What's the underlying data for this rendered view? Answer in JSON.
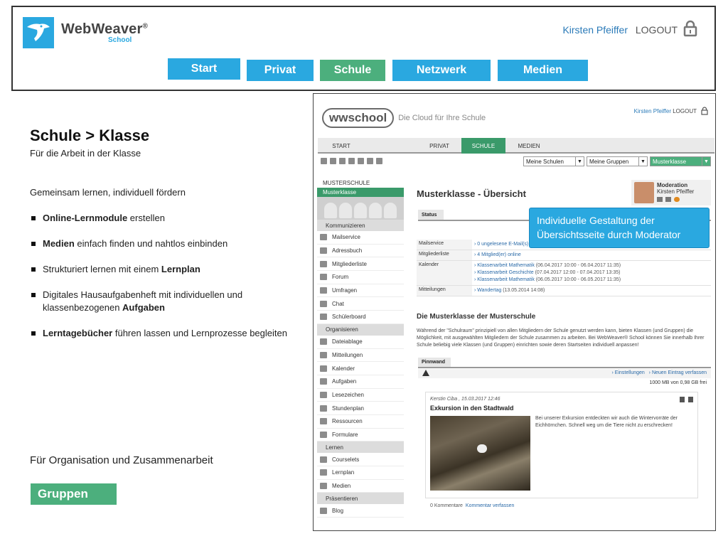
{
  "header": {
    "brand": "WebWeaver",
    "brand_mark": "®",
    "brand_sub": "School",
    "user": "Kirsten Pfeiffer",
    "logout": "LOGOUT",
    "nav": [
      {
        "label": "Start",
        "color": "#2aa8e0"
      },
      {
        "label": "Privat",
        "color": "#2aa8e0"
      },
      {
        "label": "Schule",
        "color": "#4caf7d"
      },
      {
        "label": "Netzwerk",
        "color": "#2aa8e0"
      },
      {
        "label": "Medien",
        "color": "#2aa8e0"
      }
    ]
  },
  "left": {
    "title": "Schule > Klasse",
    "subtitle": "Für die Arbeit in der Klasse",
    "lead": "Gemeinsam lernen, individuell fördern",
    "bullets": [
      {
        "bold_start": "Online-Lernmodule",
        "rest": " erstellen"
      },
      {
        "bold_start": "Medien",
        "rest": " einfach finden und nahtlos einbinden"
      },
      {
        "pre": "Strukturiert lernen mit einem ",
        "bold_end": "Lernplan"
      },
      {
        "pre": "Digitales Hausaufgabenheft mit individuellen und klassenbezogenen ",
        "bold_end": "Aufgaben"
      },
      {
        "bold_start": "Lerntagebücher",
        "rest": " führen lassen und Lernprozesse begleiten"
      }
    ],
    "org": "Für Organisation und Zusammenarbeit",
    "gruppen": "Gruppen"
  },
  "shot": {
    "logo": "wwschool",
    "tagline": "Die Cloud für Ihre Schule",
    "user": "Kirsten Pfeiffer",
    "logout": "LOGOUT",
    "tabs": [
      "START",
      "PRIVAT",
      "SCHULE",
      "MEDIEN"
    ],
    "selects": [
      "Meine Schulen",
      "Meine Gruppen",
      "Musterklasse"
    ],
    "school": "MUSTERSCHULE",
    "active_item": "Musterklasse",
    "sidebar": [
      {
        "head": "Kommunizieren",
        "items": [
          "Mailservice",
          "Adressbuch",
          "Mitgliederliste",
          "Forum",
          "Umfragen",
          "Chat",
          "Schülerboard"
        ]
      },
      {
        "head": "Organisieren",
        "items": [
          "Dateiablage",
          "Mitteilungen",
          "Kalender",
          "Aufgaben",
          "Lesezeichen",
          "Stundenplan",
          "Ressourcen",
          "Formulare"
        ]
      },
      {
        "head": "Lernen",
        "items": [
          "Courselets",
          "Lernplan",
          "Medien"
        ]
      },
      {
        "head": "Präsentieren",
        "items": [
          "Blog"
        ]
      }
    ],
    "main_title": "Musterklasse - Übersicht",
    "moderation_title": "Moderation",
    "moderation_name": "Kirsten Pfeiffer",
    "status_tab": "Status",
    "callout": "Individuelle Gestaltung der Übersichtsseite durch Moderator",
    "status_rows": [
      {
        "key": "Mailservice",
        "lines": [
          {
            "link": "› 0 ungelesene E-Mail(s)",
            "rest": ""
          }
        ]
      },
      {
        "key": "Mitgliederliste",
        "lines": [
          {
            "link": "› 4 Mitglied(er) online",
            "rest": ""
          }
        ]
      },
      {
        "key": "Kalender",
        "lines": [
          {
            "link": "› Klassenarbeit Mathematik",
            "rest": " (06.04.2017 10:00 - 06.04.2017 11:35)"
          },
          {
            "link": "› Klassenarbeit Geschichte",
            "rest": " (07.04.2017 12:00 - 07.04.2017 13:35)"
          },
          {
            "link": "› Klassenarbeit Mathematik",
            "rest": " (06.05.2017 10:00 - 06.05.2017 11:35)"
          }
        ]
      },
      {
        "key": "Mitteilungen",
        "lines": [
          {
            "link": "› Wandertag",
            "rest": " (13.05.2014 14:08)"
          }
        ]
      }
    ],
    "section_title": "Die Musterklasse der Musterschule",
    "section_text": "Während der \"Schulraum\" prinzipiell von allen Mitgliedern der Schule genutzt werden kann, bieten Klassen (und Gruppen) die Möglichkeit, mit ausgewählten Mitgliedern der Schule zusammen zu arbeiten. Bei WebWeaver® School können Sie innerhalb Ihrer Schule beliebig viele Klassen (und Gruppen) einrichten sowie deren Startseiten individuell anpassen!",
    "pinnwand_tab": "Pinnwand",
    "pin_settings": "› Einstellungen",
    "pin_new": "› Neuen Eintrag verfassen",
    "quota": "1000 MB von 0,98 GB frei",
    "post": {
      "meta": "Kerstin Ciba , 15.03.2017 12:46",
      "title": "Exkursion in den Stadtwald",
      "text": "Bei unserer Exkursion entdeckten wir auch die Wintervorräte der Eichhörnchen. Schnell weg um die Tiere nicht zu erschrecken!",
      "comments": "0 Kommentare",
      "comment_link": "Kommentar verfassen"
    }
  }
}
